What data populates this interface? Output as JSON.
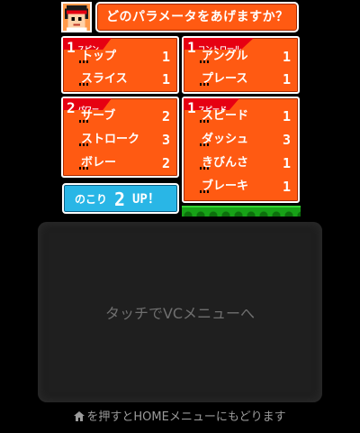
{
  "question": "どのパラメータをあげますか？",
  "categories": [
    {
      "tag": "スピン",
      "level": "1",
      "rows": [
        {
          "label": "トップ",
          "value": "1"
        },
        {
          "label": "スライス",
          "value": "1"
        }
      ]
    },
    {
      "tag": "コントロール",
      "level": "1",
      "rows": [
        {
          "label": "アングル",
          "value": "1"
        },
        {
          "label": "プレース",
          "value": "1"
        }
      ]
    },
    {
      "tag": "パワー",
      "level": "2",
      "rows": [
        {
          "label": "サーブ",
          "value": "2"
        },
        {
          "label": "ストローク",
          "value": "3"
        },
        {
          "label": "ボレー",
          "value": "2"
        }
      ]
    },
    {
      "tag": "スピード",
      "level": "1",
      "rows": [
        {
          "label": "スピード",
          "value": "1"
        },
        {
          "label": "ダッシュ",
          "value": "3"
        },
        {
          "label": "きびんさ",
          "value": "1"
        },
        {
          "label": "ブレーキ",
          "value": "1"
        }
      ]
    }
  ],
  "remaining": {
    "prefix": "のこり",
    "count": "2",
    "suffix": "UP！"
  },
  "touch_message": "タッチでVCメニューへ",
  "home_hint": "を押すとHOMEメニューにもどります",
  "colors": {
    "panel": "#ff5a12",
    "tag": "#e60012",
    "remaining_bg": "#29b6e6",
    "court": "#17a217"
  }
}
